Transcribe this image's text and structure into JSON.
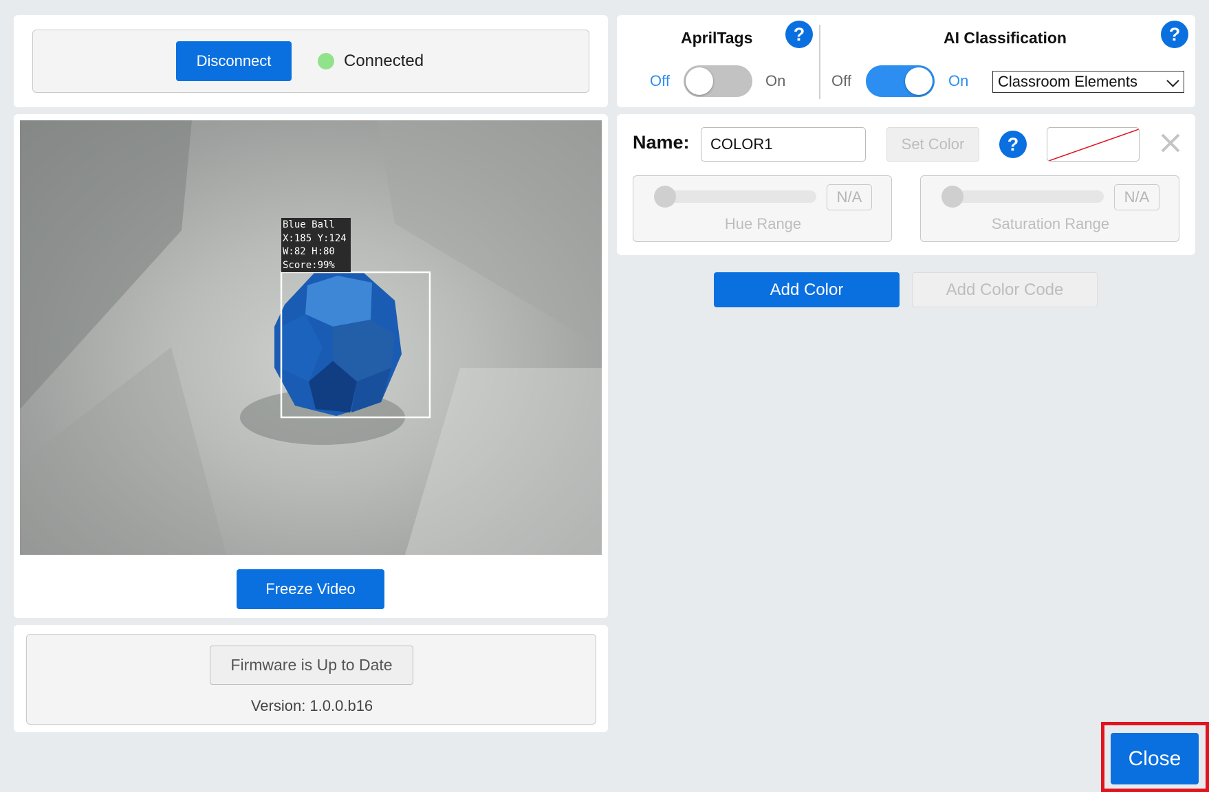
{
  "connection": {
    "disconnect_label": "Disconnect",
    "status_text": "Connected",
    "status_color": "#90e38a"
  },
  "video": {
    "overlay": {
      "line1": "Blue Ball",
      "line2": "X:185 Y:124",
      "line3": "W:82 H:80",
      "line4": "Score:99%"
    },
    "freeze_label": "Freeze Video"
  },
  "firmware": {
    "status_label": "Firmware is Up to Date",
    "version_text": "Version: 1.0.0.b16"
  },
  "apriltags": {
    "title": "AprilTags",
    "off_label": "Off",
    "on_label": "On",
    "enabled": false,
    "help_symbol": "?"
  },
  "ai_classification": {
    "title": "AI Classification",
    "off_label": "Off",
    "on_label": "On",
    "enabled": true,
    "help_symbol": "?",
    "model_selected": "Classroom Elements"
  },
  "color_editor": {
    "name_label": "Name:",
    "name_value": "COLOR1",
    "set_color_label": "Set Color",
    "help_symbol": "?",
    "remove_icon": "close-icon",
    "hue": {
      "value_text": "N/A",
      "label": "Hue Range"
    },
    "saturation": {
      "value_text": "N/A",
      "label": "Saturation Range"
    }
  },
  "actions": {
    "add_color_label": "Add Color",
    "add_color_code_label": "Add Color Code"
  },
  "footer": {
    "close_label": "Close",
    "highlight_color": "#e0141e"
  },
  "colors": {
    "accent": "#0a70e0",
    "toggle_on": "#2b8ef0",
    "toggle_off": "#c2c2c2"
  }
}
